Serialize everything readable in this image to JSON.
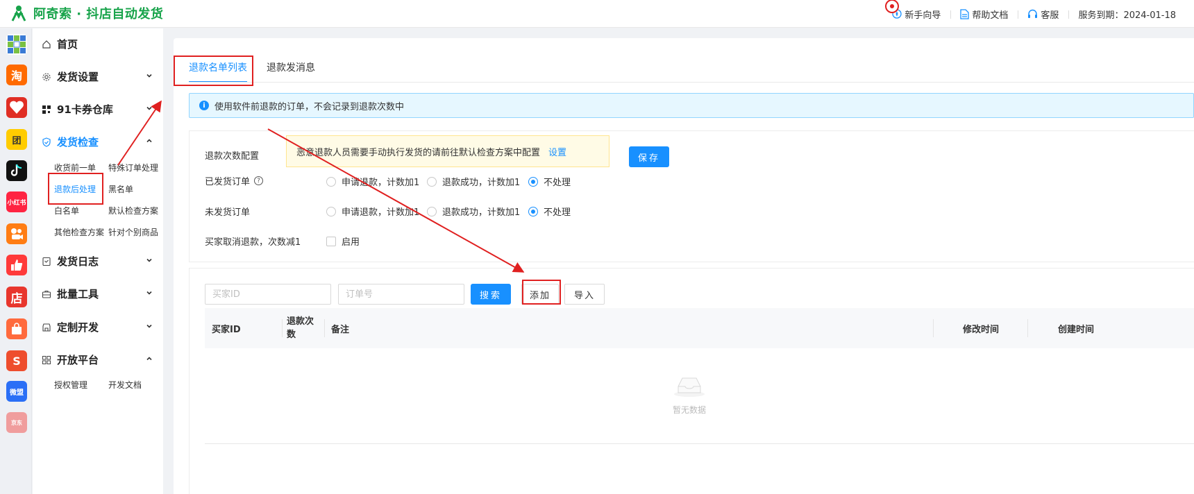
{
  "app": {
    "title": "阿奇索 · 抖店自动发货"
  },
  "header": {
    "nav": [
      {
        "label": "新手向导",
        "icon": "compass-icon"
      },
      {
        "label": "帮助文档",
        "icon": "document-icon"
      },
      {
        "label": "客服",
        "icon": "headset-icon"
      }
    ],
    "service_expiry": "服务到期：2024-01-18"
  },
  "rail": {
    "apps": [
      {
        "name": "grid-app-icon",
        "glyph": "",
        "color": "#3a7bd5"
      },
      {
        "name": "taobao-app-icon",
        "glyph": "淘",
        "color": "#ff6a00"
      },
      {
        "name": "pinduoduo-app-icon",
        "glyph": "",
        "color": "#e02e24"
      },
      {
        "name": "kuaishou-app-icon",
        "glyph": "团",
        "color": "#ffcc00"
      },
      {
        "name": "douyin-app-icon",
        "glyph": "",
        "color": "#111111"
      },
      {
        "name": "xiaohongshu-app-icon",
        "glyph": "小红书",
        "color": "#ff2442"
      },
      {
        "name": "kuaishou-shop-app-icon",
        "glyph": "",
        "color": "#ff7d14"
      },
      {
        "name": "like-app-icon",
        "glyph": "",
        "color": "#ff3a3a"
      },
      {
        "name": "store-app-icon",
        "glyph": "店",
        "color": "#e8362d"
      },
      {
        "name": "bag-app-icon",
        "glyph": "",
        "color": "#ff6a3d"
      },
      {
        "name": "shopee-app-icon",
        "glyph": "S",
        "color": "#ee4d2d"
      },
      {
        "name": "weimeng-app-icon",
        "glyph": "微盟",
        "color": "#2a6ff6"
      },
      {
        "name": "jd-app-icon",
        "glyph": "京东",
        "color": "#f09d9d"
      }
    ]
  },
  "sidebar": {
    "home": "首页",
    "delivery_settings": "发货设置",
    "warehouse": "91卡券仓库",
    "delivery_check": "发货检查",
    "check_items": [
      "收货前一单",
      "特殊订单处理",
      "退款后处理",
      "黑名单",
      "白名单",
      "默认检查方案",
      "其他检查方案",
      "针对个别商品"
    ],
    "delivery_log": "发货日志",
    "batch_tools": "批量工具",
    "custom_dev": "定制开发",
    "open_platform": "开放平台",
    "platform_items": [
      "授权管理",
      "开发文档"
    ]
  },
  "main": {
    "tabs": [
      "退款名单列表",
      "退款发消息"
    ],
    "info": "使用软件前退款的订单，不会记录到退款次数中",
    "config": {
      "refund_count_label": "退款次数配置",
      "warning": "恶意退款人员需要手动执行发货的请前往默认检查方案中配置",
      "warning_link": "设置",
      "save": "保存",
      "shipped_label": "已发货订单",
      "unshipped_label": "未发货订单",
      "options": [
        "申请退款，计数加1",
        "退款成功，计数加1",
        "不处理"
      ],
      "shipped_selected": "不处理",
      "unshipped_selected": "不处理",
      "cancel_label": "买家取消退款，次数减1",
      "cancel_option": "启用"
    },
    "list": {
      "buyer_placeholder": "买家ID",
      "order_placeholder": "订单号",
      "search": "搜索",
      "add": "添加",
      "import": "导入",
      "columns": [
        "买家ID",
        "退款次数",
        "备注",
        "修改时间",
        "创建时间"
      ],
      "empty": "暂无数据"
    }
  }
}
